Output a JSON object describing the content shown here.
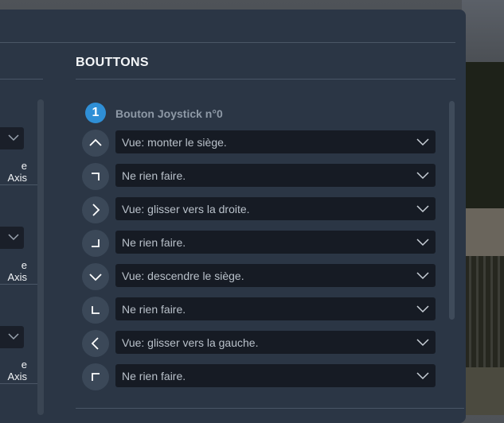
{
  "section": {
    "title": "BOUTTONS"
  },
  "joystick": {
    "number": "1",
    "label": "Bouton Joystick n°0"
  },
  "left_column": {
    "axis_labels": [
      "e Axis",
      "e Axis",
      "e Axis"
    ]
  },
  "rows": [
    {
      "icon": "arrow-up-icon",
      "value": "Vue: monter le siège."
    },
    {
      "icon": "corner-top-right-icon",
      "value": "Ne rien faire."
    },
    {
      "icon": "arrow-right-icon",
      "value": "Vue: glisser vers la droite."
    },
    {
      "icon": "corner-bottom-right-icon",
      "value": "Ne rien faire."
    },
    {
      "icon": "arrow-down-icon",
      "value": "Vue: descendre le siège."
    },
    {
      "icon": "corner-bottom-left-icon",
      "value": "Ne rien faire."
    },
    {
      "icon": "arrow-left-icon",
      "value": "Vue: glisser vers la gauche."
    },
    {
      "icon": "corner-top-left-icon",
      "value": "Ne rien faire."
    }
  ],
  "colors": {
    "panel": "#2b3645",
    "accent": "#2f8fd6",
    "select_bg": "#161b24"
  }
}
